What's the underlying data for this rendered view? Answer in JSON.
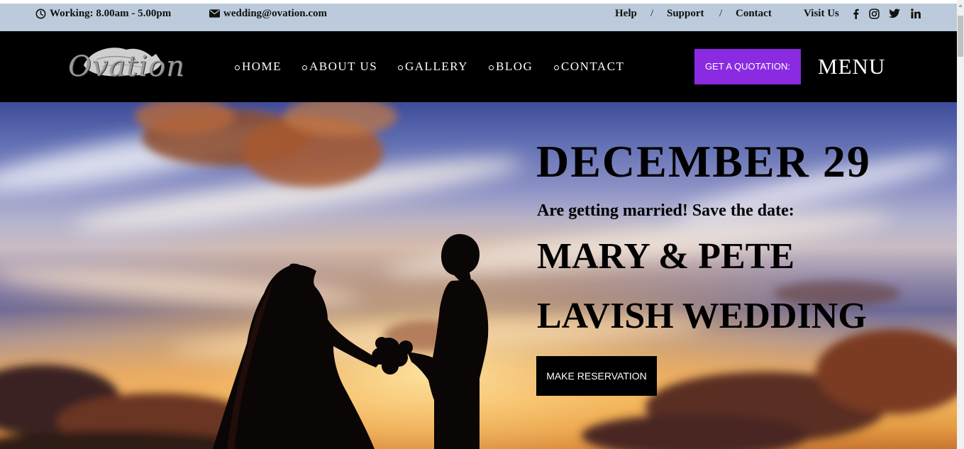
{
  "topbar": {
    "working_hours": "Working: 8.00am - 5.00pm",
    "email": "wedding@ovation.com",
    "links": [
      "Help",
      "Support",
      "Contact"
    ],
    "separator": "/",
    "visit_label": "Visit Us",
    "icons": {
      "clock": "clock-icon",
      "email": "envelope-icon",
      "social": [
        "facebook-icon",
        "instagram-icon",
        "twitter-icon",
        "linkedin-icon"
      ]
    }
  },
  "brand": {
    "logo_text": "Ovation"
  },
  "nav": {
    "items": [
      "HOME",
      "ABOUT US",
      "GALLERY",
      "BLOG",
      "CONTACT"
    ],
    "quote_button": "GET A QUOTATION:",
    "menu_label": "MENU"
  },
  "hero": {
    "date": "DECEMBER 29",
    "subtitle": "Are getting married! Save the date:",
    "names": "MARY & PETE",
    "event": "LAVISH WEDDING",
    "cta": "MAKE RESERVATION"
  },
  "colors": {
    "topbar_bg": "#bccbdb",
    "nav_bg": "#000000",
    "accent": "#8a2be2",
    "text_dark": "#000000",
    "text_light": "#ffffff"
  }
}
